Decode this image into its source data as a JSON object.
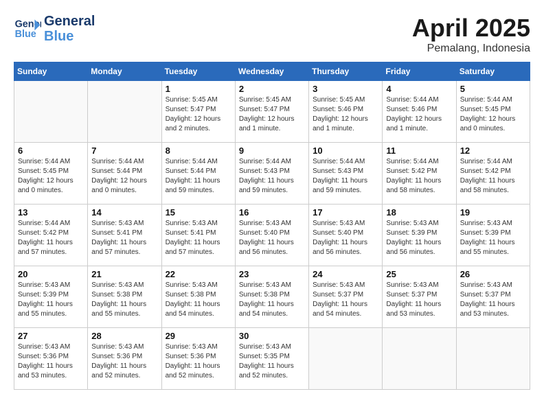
{
  "header": {
    "logo_line1": "General",
    "logo_line2": "Blue",
    "month": "April 2025",
    "location": "Pemalang, Indonesia"
  },
  "weekdays": [
    "Sunday",
    "Monday",
    "Tuesday",
    "Wednesday",
    "Thursday",
    "Friday",
    "Saturday"
  ],
  "weeks": [
    [
      {
        "day": "",
        "info": ""
      },
      {
        "day": "",
        "info": ""
      },
      {
        "day": "1",
        "info": "Sunrise: 5:45 AM\nSunset: 5:47 PM\nDaylight: 12 hours\nand 2 minutes."
      },
      {
        "day": "2",
        "info": "Sunrise: 5:45 AM\nSunset: 5:47 PM\nDaylight: 12 hours\nand 1 minute."
      },
      {
        "day": "3",
        "info": "Sunrise: 5:45 AM\nSunset: 5:46 PM\nDaylight: 12 hours\nand 1 minute."
      },
      {
        "day": "4",
        "info": "Sunrise: 5:44 AM\nSunset: 5:46 PM\nDaylight: 12 hours\nand 1 minute."
      },
      {
        "day": "5",
        "info": "Sunrise: 5:44 AM\nSunset: 5:45 PM\nDaylight: 12 hours\nand 0 minutes."
      }
    ],
    [
      {
        "day": "6",
        "info": "Sunrise: 5:44 AM\nSunset: 5:45 PM\nDaylight: 12 hours\nand 0 minutes."
      },
      {
        "day": "7",
        "info": "Sunrise: 5:44 AM\nSunset: 5:44 PM\nDaylight: 12 hours\nand 0 minutes."
      },
      {
        "day": "8",
        "info": "Sunrise: 5:44 AM\nSunset: 5:44 PM\nDaylight: 11 hours\nand 59 minutes."
      },
      {
        "day": "9",
        "info": "Sunrise: 5:44 AM\nSunset: 5:43 PM\nDaylight: 11 hours\nand 59 minutes."
      },
      {
        "day": "10",
        "info": "Sunrise: 5:44 AM\nSunset: 5:43 PM\nDaylight: 11 hours\nand 59 minutes."
      },
      {
        "day": "11",
        "info": "Sunrise: 5:44 AM\nSunset: 5:42 PM\nDaylight: 11 hours\nand 58 minutes."
      },
      {
        "day": "12",
        "info": "Sunrise: 5:44 AM\nSunset: 5:42 PM\nDaylight: 11 hours\nand 58 minutes."
      }
    ],
    [
      {
        "day": "13",
        "info": "Sunrise: 5:44 AM\nSunset: 5:42 PM\nDaylight: 11 hours\nand 57 minutes."
      },
      {
        "day": "14",
        "info": "Sunrise: 5:43 AM\nSunset: 5:41 PM\nDaylight: 11 hours\nand 57 minutes."
      },
      {
        "day": "15",
        "info": "Sunrise: 5:43 AM\nSunset: 5:41 PM\nDaylight: 11 hours\nand 57 minutes."
      },
      {
        "day": "16",
        "info": "Sunrise: 5:43 AM\nSunset: 5:40 PM\nDaylight: 11 hours\nand 56 minutes."
      },
      {
        "day": "17",
        "info": "Sunrise: 5:43 AM\nSunset: 5:40 PM\nDaylight: 11 hours\nand 56 minutes."
      },
      {
        "day": "18",
        "info": "Sunrise: 5:43 AM\nSunset: 5:39 PM\nDaylight: 11 hours\nand 56 minutes."
      },
      {
        "day": "19",
        "info": "Sunrise: 5:43 AM\nSunset: 5:39 PM\nDaylight: 11 hours\nand 55 minutes."
      }
    ],
    [
      {
        "day": "20",
        "info": "Sunrise: 5:43 AM\nSunset: 5:39 PM\nDaylight: 11 hours\nand 55 minutes."
      },
      {
        "day": "21",
        "info": "Sunrise: 5:43 AM\nSunset: 5:38 PM\nDaylight: 11 hours\nand 55 minutes."
      },
      {
        "day": "22",
        "info": "Sunrise: 5:43 AM\nSunset: 5:38 PM\nDaylight: 11 hours\nand 54 minutes."
      },
      {
        "day": "23",
        "info": "Sunrise: 5:43 AM\nSunset: 5:38 PM\nDaylight: 11 hours\nand 54 minutes."
      },
      {
        "day": "24",
        "info": "Sunrise: 5:43 AM\nSunset: 5:37 PM\nDaylight: 11 hours\nand 54 minutes."
      },
      {
        "day": "25",
        "info": "Sunrise: 5:43 AM\nSunset: 5:37 PM\nDaylight: 11 hours\nand 53 minutes."
      },
      {
        "day": "26",
        "info": "Sunrise: 5:43 AM\nSunset: 5:37 PM\nDaylight: 11 hours\nand 53 minutes."
      }
    ],
    [
      {
        "day": "27",
        "info": "Sunrise: 5:43 AM\nSunset: 5:36 PM\nDaylight: 11 hours\nand 53 minutes."
      },
      {
        "day": "28",
        "info": "Sunrise: 5:43 AM\nSunset: 5:36 PM\nDaylight: 11 hours\nand 52 minutes."
      },
      {
        "day": "29",
        "info": "Sunrise: 5:43 AM\nSunset: 5:36 PM\nDaylight: 11 hours\nand 52 minutes."
      },
      {
        "day": "30",
        "info": "Sunrise: 5:43 AM\nSunset: 5:35 PM\nDaylight: 11 hours\nand 52 minutes."
      },
      {
        "day": "",
        "info": ""
      },
      {
        "day": "",
        "info": ""
      },
      {
        "day": "",
        "info": ""
      }
    ]
  ]
}
